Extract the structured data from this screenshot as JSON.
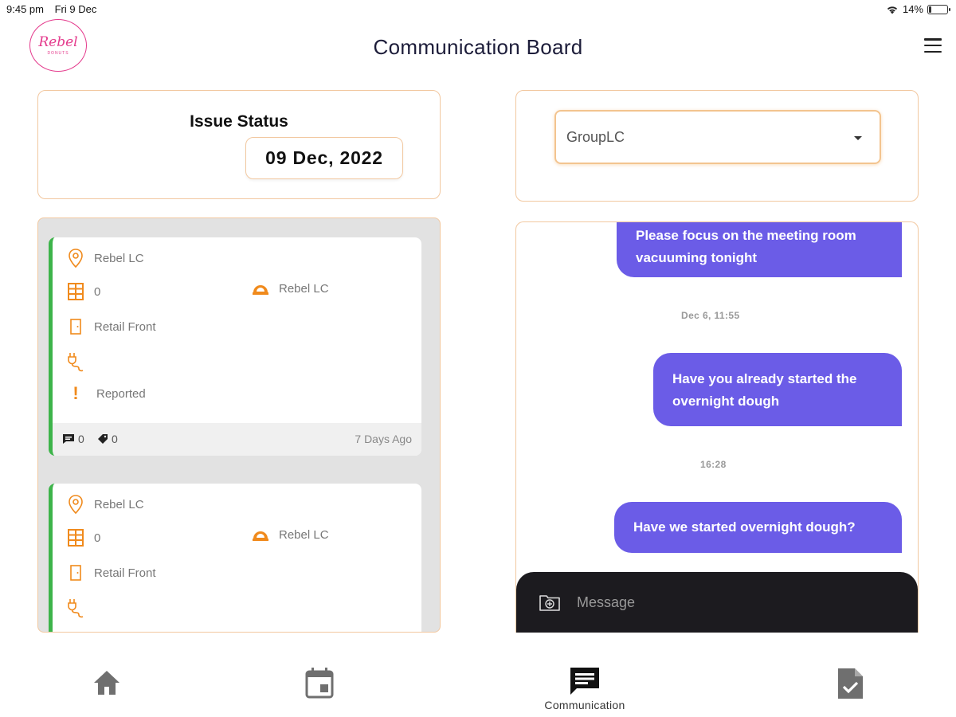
{
  "status_bar": {
    "time": "9:45 pm",
    "date": "Fri 9 Dec",
    "battery": "14%",
    "battery_level": 0.14
  },
  "header": {
    "title": "Communication Board",
    "logo_text": "Rebel",
    "logo_sub": "DONUTS"
  },
  "issue_status": {
    "title": "Issue Status",
    "date": "09 Dec, 2022"
  },
  "group_select": {
    "value": "GroupLC"
  },
  "issues": [
    {
      "location": "Rebel LC",
      "floor": "0",
      "department": "Rebel LC",
      "area": "Retail Front",
      "status": "Reported",
      "comments": "0",
      "tags": "0",
      "age": "7 Days Ago"
    },
    {
      "location": "Rebel LC",
      "floor": "0",
      "department": "Rebel LC",
      "area": "Retail Front"
    }
  ],
  "chat": {
    "messages": [
      {
        "text1": "Please focus on the meeting room",
        "text2": "vacuuming tonight"
      },
      {
        "text1": "Have you already started the",
        "text2": "overnight dough"
      },
      {
        "text1": "Have we started overnight dough?"
      }
    ],
    "stamps": [
      "Dec 6, 11:55",
      "16:28"
    ],
    "input_placeholder": "Message"
  },
  "nav": {
    "items": [
      {
        "icon": "home-icon",
        "label": ""
      },
      {
        "icon": "calendar-icon",
        "label": ""
      },
      {
        "icon": "chat-icon",
        "label": "Communication"
      },
      {
        "icon": "task-icon",
        "label": ""
      }
    ]
  },
  "colors": {
    "accent": "#6b5ce7",
    "orange": "#f08a1c",
    "green": "#3db44a",
    "brand_pink": "#e43a8c"
  }
}
